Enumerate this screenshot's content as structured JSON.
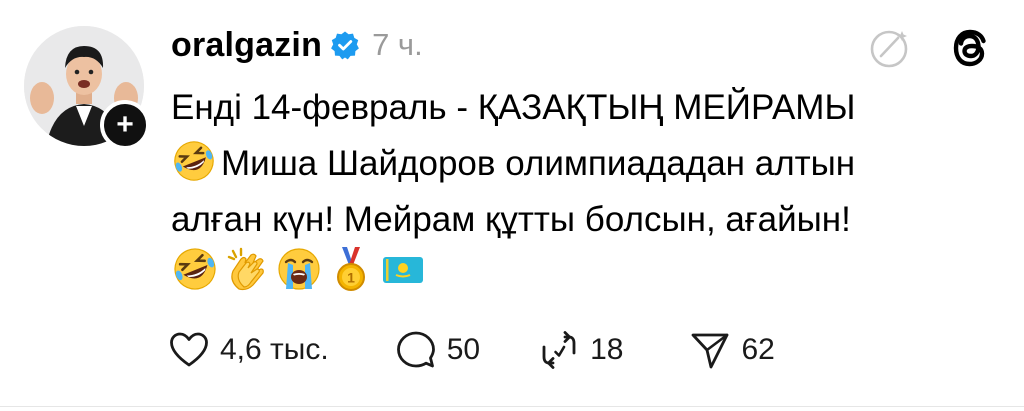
{
  "post": {
    "author": {
      "username": "oralgazin",
      "verified": true,
      "avatar_icon": "avatar-photo"
    },
    "time_ago": "7 ч.",
    "follow_icon": "plus-icon",
    "text_lines": [
      "Енді 14-февраль - ҚАЗАҚТЫҢ МЕЙРАМЫ",
      "Миша Шайдоров олимпиададан алтын",
      "алған күн! Мейрам құтты болсын, ағайын!"
    ],
    "line2_leading_emoji": "rolling-on-floor-laughing",
    "trailing_emojis": [
      "rolling-on-floor-laughing",
      "clapping-hands",
      "loudly-crying-face",
      "first-place-medal",
      "flag-kazakhstan"
    ],
    "actions": {
      "likes": "4,6 тыс.",
      "replies": "50",
      "reposts": "18",
      "shares": "62"
    }
  },
  "colors": {
    "accent_verified": "#1d9bf0",
    "text": "#000000",
    "muted": "#9a9a9a"
  }
}
